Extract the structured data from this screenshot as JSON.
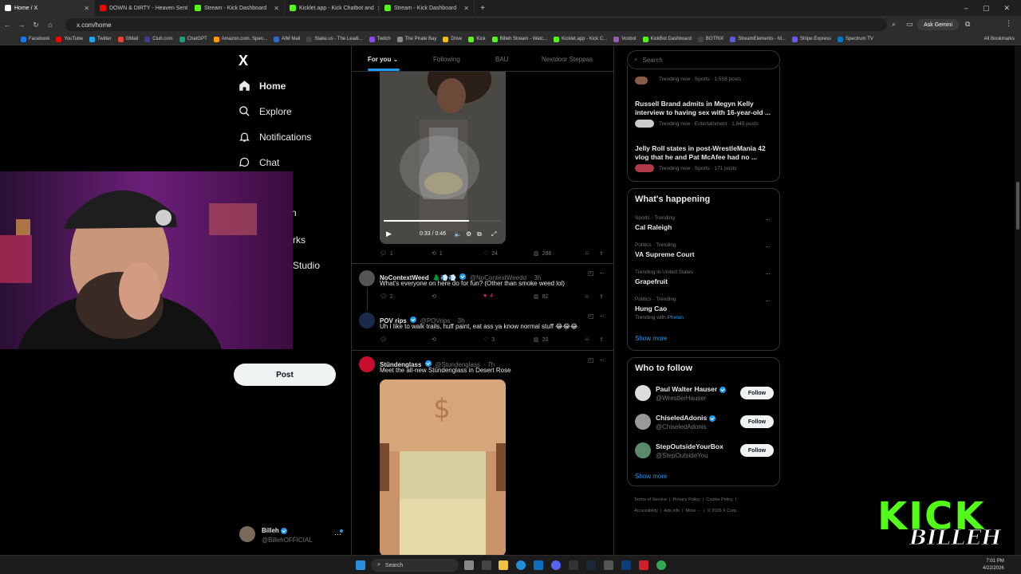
{
  "browser": {
    "tabs": [
      {
        "title": "Home / X",
        "color": "#ffffff",
        "active": true
      },
      {
        "title": "DOWN & DIRTY - Heaven Sent",
        "color": "#ff0000"
      },
      {
        "title": "Stream - Kick Dashboard",
        "color": "#53fc18"
      },
      {
        "title": "Kicklet.app - Kick Chatbot and",
        "color": "#53fc18"
      },
      {
        "title": "Stream - Kick Dashboard",
        "color": "#53fc18"
      }
    ],
    "url": "x.com/home",
    "ask_gemini": "Ask Gemini",
    "bookmarks": [
      "Facebook",
      "YouTube",
      "Twitter",
      "GMail",
      "Club.com",
      "ChatGPT",
      "Amazon.com. Spen...",
      "AIM Mail",
      "Stake.us - The Leadi...",
      "Twitch",
      "The Pirate Bay",
      "Drive",
      "Kick",
      "Billeh Stream - Watc...",
      "Kicklet.app - Kick C...",
      "Voxbot",
      "KickBot Dashboard",
      "BOTRIX",
      "StreamElements - M...",
      "Stripe Express",
      "Spectrum TV"
    ],
    "all_bookmarks": "All Bookmarks"
  },
  "sidebar": {
    "logo": "X",
    "items": [
      {
        "label": "Home",
        "icon": "home-icon"
      },
      {
        "label": "Explore",
        "icon": "search-icon"
      },
      {
        "label": "Notifications",
        "icon": "bell-icon"
      },
      {
        "label": "Chat",
        "icon": "chat-icon"
      }
    ],
    "partial_labels": [
      "n",
      "rks",
      "Studio"
    ],
    "post_label": "Post",
    "account": {
      "name": "Billeh",
      "handle": "@BillehOFFICIAL"
    }
  },
  "feed": {
    "tabs": [
      "For you",
      "Following",
      "BAU",
      "Nextdoor Steppas"
    ],
    "video": {
      "time": "0:33 / 0:46"
    },
    "video_actions": {
      "replies": "1",
      "reposts": "1",
      "likes": "24",
      "views": "288"
    },
    "tweets": [
      {
        "name": "NoContextWeed",
        "emoji": "🌲💨💨",
        "handle": "@NoContextWeedd",
        "time": "· 3h",
        "text": "What's everyone on here do for fun? (Other than smoke weed lol)",
        "replies": "2",
        "reposts": "",
        "likes": "4",
        "views": "82"
      },
      {
        "name": "POV rips",
        "handle": "@POVrips",
        "time": "· 3h",
        "text": "Uh I like to walk trails, huff paint, eat ass ya know normal stuff 😂😂😂",
        "replies": "",
        "reposts": "",
        "likes": "3",
        "views": "20"
      },
      {
        "name": "Stündenglass",
        "handle": "@Stundenglass",
        "time": "· 7h",
        "text": "Meet the all-new Stündenglass in Desert Rose"
      }
    ]
  },
  "right": {
    "search_placeholder": "Search",
    "trends_top": [
      {
        "meta": "Trending now · Sports · 1,558 posts"
      },
      {
        "title": "Russell Brand admits in Megyn Kelly interview to having sex with 16-year-old ...",
        "meta": "Trending now · Entertainment · 1,845 posts"
      },
      {
        "title": "Jelly Roll states in post-WrestleMania 42 vlog that he and Pat McAfee had no ...",
        "meta": "Trending now · Sports · 171 posts"
      }
    ],
    "happening_title": "What's happening",
    "happening": [
      {
        "meta": "Sports · Trending",
        "title": "Cal Raleigh"
      },
      {
        "meta": "Politics · Trending",
        "title": "VA Supreme Court"
      },
      {
        "meta": "Trending in United States",
        "title": "Grapefruit"
      },
      {
        "meta": "Politics · Trending",
        "title": "Hung Cao",
        "extra": "Trending with",
        "extra_link": "Phelan"
      }
    ],
    "show_more": "Show more",
    "who_title": "Who to follow",
    "who": [
      {
        "name": "Paul Walter Hauser",
        "handle": "@WrestlerHauser"
      },
      {
        "name": "ChiseledAdonis",
        "handle": "@ChiseledAdonis"
      },
      {
        "name": "StepOutsideYourBox",
        "handle": "@StepOutsideYou"
      }
    ],
    "follow_label": "Follow",
    "footer1": [
      "Terms of Service",
      "Privacy Policy",
      "Cookie Policy"
    ],
    "footer2": [
      "Accessibility",
      "Ads info",
      "More ···",
      "© 2026 X Corp."
    ]
  },
  "overlay": {
    "kick": "KICK",
    "billeh": "BILLEH"
  },
  "taskbar": {
    "search": "Search",
    "time": "7:01 PM",
    "date": "4/22/2026"
  }
}
